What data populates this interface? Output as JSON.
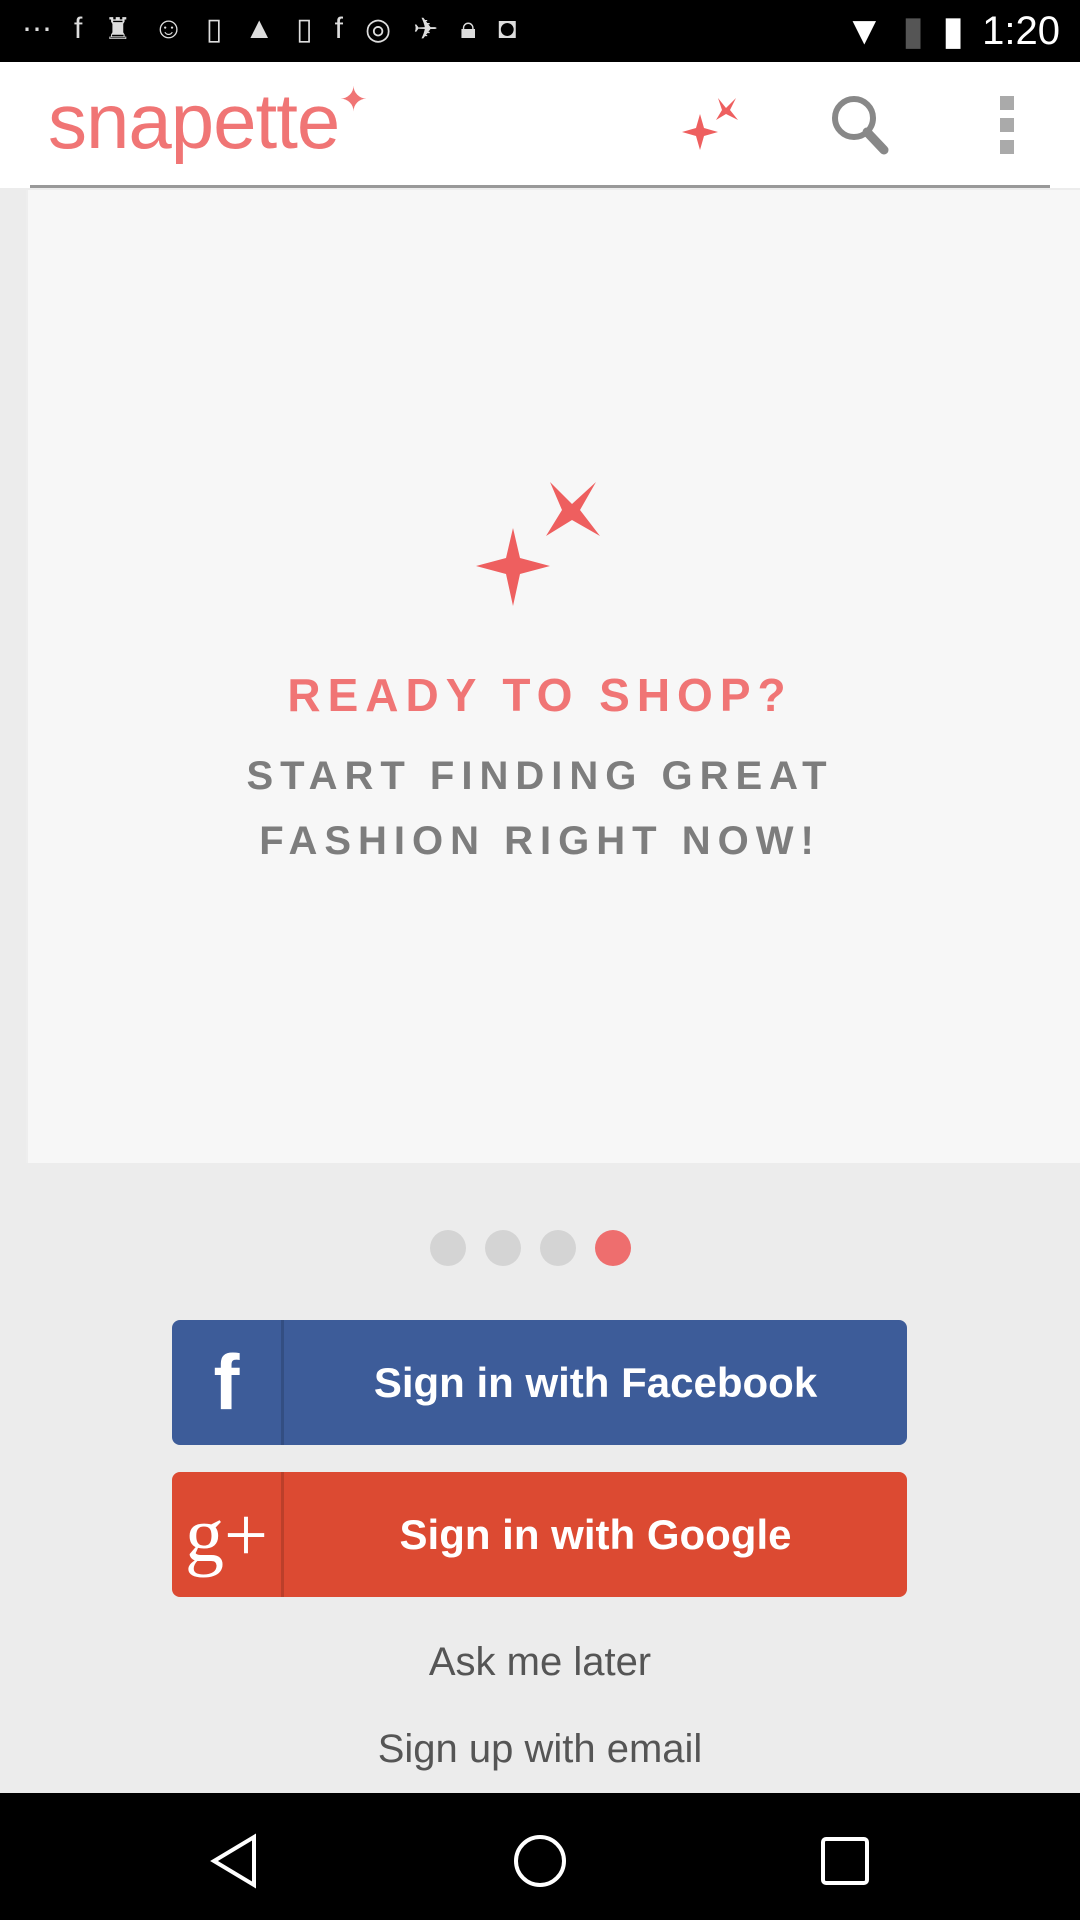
{
  "status_bar": {
    "time": "1:20",
    "icons": [
      "more-icon",
      "facebook-icon",
      "keyhole-icon",
      "cat-icon",
      "app-icon",
      "warning-icon",
      "app-icon",
      "facebook-icon",
      "circle-icon",
      "fake-gps-icon",
      "lock-icon",
      "android-icon",
      "wifi-icon",
      "no-sim-icon",
      "battery-charging-icon"
    ]
  },
  "header": {
    "logo": "snapette",
    "actions": [
      "sparkle-icon",
      "search-icon",
      "overflow-menu-icon"
    ]
  },
  "promo": {
    "headline": "READY TO SHOP?",
    "line1": "START FINDING GREAT",
    "line2": "FASHION RIGHT NOW!"
  },
  "pager": {
    "count": 4,
    "active_index": 3
  },
  "buttons": {
    "facebook": "Sign in with Facebook",
    "facebook_icon_glyph": "f",
    "google": "Sign in with Google",
    "google_icon_glyph": "g+"
  },
  "links": {
    "ask_later": "Ask me later",
    "signup_email": "Sign up with email"
  },
  "colors": {
    "brand": "#f07575",
    "facebook": "#3d5c99",
    "google": "#dc4a32"
  }
}
